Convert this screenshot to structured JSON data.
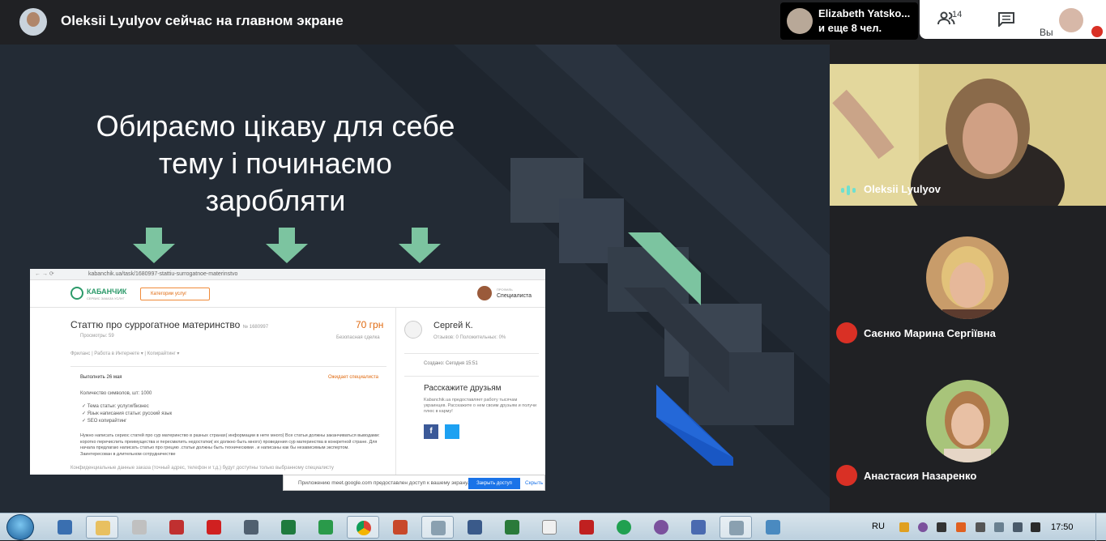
{
  "meet": {
    "presenter_title": "Oleksii Lyulyov сейчас на главном экране",
    "participant_name": "Elizabeth Yatsko...",
    "participant_more": "и еще 8 чел.",
    "people_count": "14",
    "self_label": "Вы",
    "speaker_name": "Oleksii Lyulyov",
    "tiles": [
      {
        "name": "Саєнко Марина Сергіївна",
        "muted": true
      },
      {
        "name": "Анастасия Назаренко",
        "muted": true
      }
    ]
  },
  "slide": {
    "title_line1": "Обираємо цікаву для себе",
    "title_line2": "тему і починаємо",
    "title_line3": "заробляти",
    "accent_color": "#7cc4a0"
  },
  "shot": {
    "url": "kabanchik.ua/task/1680997-stattiu-surrogatnoe-materinstvo",
    "brand": "КАБАНЧИК",
    "brand_sub": "СЕРВИС ЗАКАЗА УСЛУГ",
    "category_button": "Категории услуг",
    "profile_small": "ПРОФИЛЬ",
    "profile_role": "Специалиста",
    "task_title": "Статтю про суррогатное материнство",
    "task_id": "№ 1680997",
    "price": "70 грн",
    "views": "Просмотры: 59",
    "safe_deal": "Безопасная сделка",
    "categories": "Фриланс  |  Работа в Интернете ▾  |  Копирайтинг ▾",
    "deadline": "Выполнить 26 мая",
    "waiting": "Ожидает специалиста",
    "chars": "Количество символов, шт: 1000",
    "list": [
      "Тема статьи: услуги/бизнес",
      "Язык написания статьи: русский язык",
      "SEO копирайтинг"
    ],
    "description": "Нужно написать сериос статей про сур материнство в разных странах( информации в нете много) Все статьи должны заканчиваться выводами: коротко перечислить преимущества и пересмилить недостатки( их должно быть много) проведения сур материнства в конкретной стране. Для начала предлагаю написать статью про грецию .статьи должны быть техническими . и написаны как бы независимым экспертом. Заинтересован в длительном сотрудничестве",
    "confidential": "Конфиденциальные данные заказа (точный адрес, телефон и т.д.) будут доступны только выбранному специалисту",
    "user_name": "Сергей К.",
    "reviews": "Отзывов: 0        Положительных: 0%",
    "created": "Создано: Сегодня 15:51",
    "share_title": "Расскажите друзьям",
    "share_text": "Kabanchik.ua предоставляет работу тысячам украинцев. Расскажите о нем своим друзьям и получи плюс в карму!",
    "fb": "f"
  },
  "access": {
    "text": "Приложению meet.google.com предоставлен доступ к вашему экрану.",
    "button": "Закрыть доступ",
    "hide": "Скрыть"
  },
  "taskbar": {
    "lang": "RU",
    "time": "17:50"
  }
}
